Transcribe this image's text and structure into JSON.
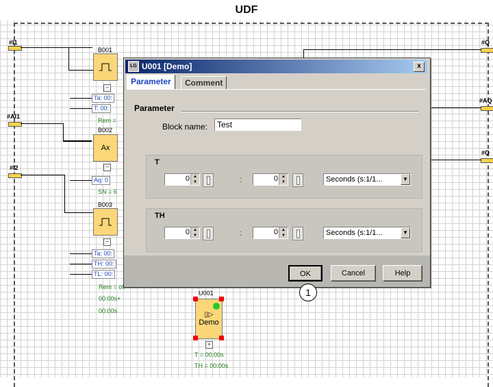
{
  "diagram": {
    "title": "UDF",
    "pins_left": [
      "#I1",
      "#AI1",
      "#I2"
    ],
    "pins_right": [
      "#Q",
      "#AQ",
      "#Q"
    ],
    "blocks": [
      {
        "id": "B001",
        "params": [
          "Ta: 00:",
          "T: 00:"
        ],
        "rem": "Rem ="
      },
      {
        "id": "B002",
        "glyph": "Ax",
        "params": [
          "Aq: 0"
        ],
        "sn": "SN = 6"
      },
      {
        "id": "B003",
        "params": [
          "Ta: 00:",
          "TH: 00:",
          "TL: 00:"
        ],
        "rem": "Rem = off",
        "t1": "00:00s+",
        "t2": "00:00s"
      }
    ],
    "udf_block": {
      "id": "U001",
      "label": "Demo",
      "t": "T = 00:00s",
      "th": "TH = 00:00s"
    },
    "callout": "1"
  },
  "dialog": {
    "title": "U001 [Demo]",
    "close_glyph": "x",
    "tabs": [
      "Parameter",
      "Comment"
    ],
    "section_title": "Parameter",
    "block_name_label": "Block name:",
    "block_name_value": "Test",
    "groups": [
      {
        "title": "T",
        "val1": "0",
        "val2": "0",
        "colon": ":",
        "unit": "Seconds (s:1/1..."
      },
      {
        "title": "TH",
        "val1": "0",
        "val2": "0",
        "colon": ":",
        "unit": "Seconds (s:1/1..."
      }
    ],
    "buttons": {
      "ok": "OK",
      "cancel": "Cancel",
      "help": "Help"
    }
  }
}
